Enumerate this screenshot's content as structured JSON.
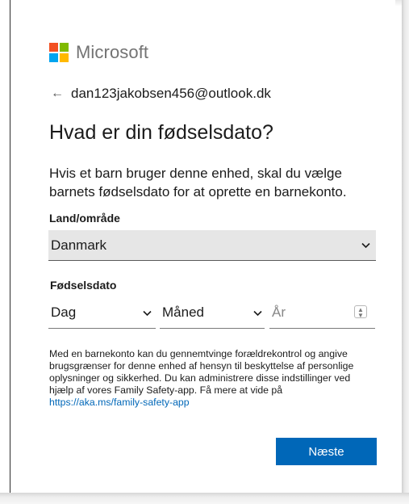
{
  "brand": {
    "name": "Microsoft"
  },
  "account": {
    "email": "dan123jakobsen456@outlook.dk",
    "back_icon": "arrow-left-icon"
  },
  "page": {
    "title": "Hvad er din fødselsdato?",
    "description": "Hvis et barn bruger denne enhed, skal du vælge barnets fødselsdato for at oprette en barnekonto."
  },
  "country": {
    "label": "Land/område",
    "value": "Danmark"
  },
  "birthdate": {
    "label": "Fødselsdato",
    "day_value": "Dag",
    "month_value": "Måned",
    "year_placeholder": "År"
  },
  "info": {
    "text": "Med en barnekonto kan du gennemtvinge forældrekontrol og angive brugsgrænser for denne enhed af hensyn til beskyttelse af personlige oplysninger og sikkerhed. Du kan administrere disse indstillinger ved hjælp af vores Family Safety-app. Få mere at vide på ",
    "link": "https://aka.ms/family-safety-app"
  },
  "actions": {
    "next_label": "Næste"
  },
  "colors": {
    "accent": "#0067b8",
    "logo_red": "#f25022",
    "logo_green": "#7fba00",
    "logo_blue": "#00a4ef",
    "logo_yellow": "#ffb900"
  }
}
